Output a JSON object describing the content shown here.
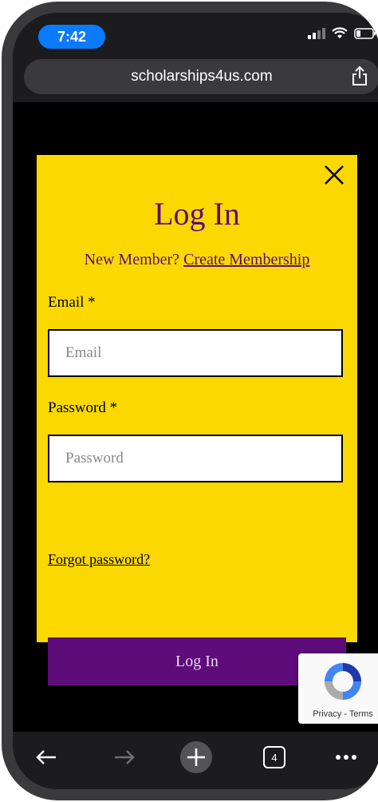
{
  "status": {
    "time": "7:42"
  },
  "browser": {
    "url": "scholarships4us.com",
    "tab_count": "4"
  },
  "modal": {
    "title": "Log In",
    "new_member_text": "New Member?",
    "create_membership_link": "Create Membership",
    "email_label": "Email *",
    "email_placeholder": "Email",
    "password_label": "Password *",
    "password_placeholder": "Password",
    "forgot_password": "Forgot password?",
    "submit_label": "Log In"
  },
  "recaptcha": {
    "terms_text": "Privacy - Terms"
  },
  "colors": {
    "accent": "#fbd800",
    "brand_purple": "#5e0c7a",
    "ios_blue": "#0a7aff"
  },
  "icons": [
    "signal-icon",
    "wifi-icon",
    "battery-icon",
    "share-icon",
    "close-icon",
    "recaptcha-icon",
    "back-icon",
    "forward-icon",
    "new-tab-icon",
    "tabs-icon",
    "more-icon"
  ]
}
